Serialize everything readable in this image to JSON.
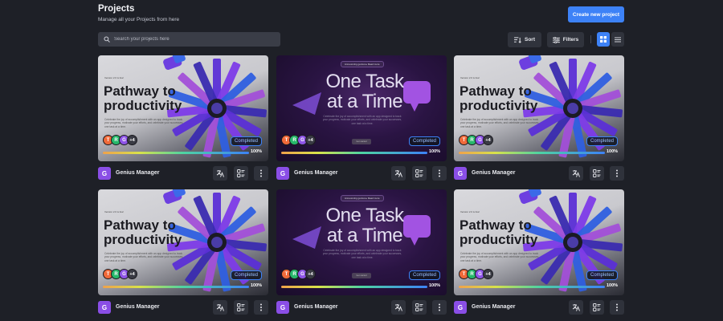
{
  "header": {
    "title": "Projects",
    "subtitle": "Manage all your Projects from here",
    "create_label": "Create new project"
  },
  "search": {
    "placeholder": "Search your projects here"
  },
  "toolbar": {
    "sort_label": "Sort",
    "filters_label": "Filters",
    "active_view": "grid"
  },
  "colors": {
    "accent": "#3d82f7",
    "background": "#1e2027",
    "manager_icon": "#8a4ee6"
  },
  "thumbs": {
    "a": {
      "version": "Version 2.0 is live!",
      "title_line1": "Pathway to",
      "title_line2": "productivity",
      "description": "Celebrate the joy of accomplishment with an app designed to track your progress, motivate your efforts, and celebrate your successes, one task at a time."
    },
    "b": {
      "pill": "Announcing genius ▸ Read more",
      "title_line1": "One Task",
      "title_line2": "at a Time",
      "description": "Celebrate the joy of accomplishment with an app designed to track your progress, motivate your efforts, and celebrate your successes, one task at a time.",
      "button": "Get started"
    }
  },
  "projects": [
    {
      "thumb": "a",
      "avatars": [
        "T",
        "R",
        "G"
      ],
      "more": "+4",
      "status": "Completed",
      "progress": 100,
      "progress_label": "100%",
      "manager_initial": "G",
      "manager": "Genius Manager"
    },
    {
      "thumb": "b",
      "avatars": [
        "T",
        "R",
        "G"
      ],
      "more": "+4",
      "status": "Completed",
      "progress": 100,
      "progress_label": "100%",
      "manager_initial": "G",
      "manager": "Genius Manager"
    },
    {
      "thumb": "a",
      "avatars": [
        "T",
        "R",
        "G"
      ],
      "more": "+4",
      "status": "Completed",
      "progress": 100,
      "progress_label": "100%",
      "manager_initial": "G",
      "manager": "Genius Manager"
    },
    {
      "thumb": "a",
      "avatars": [
        "T",
        "R",
        "G"
      ],
      "more": "+4",
      "status": "Completed",
      "progress": 100,
      "progress_label": "100%",
      "manager_initial": "G",
      "manager": "Genius Manager"
    },
    {
      "thumb": "b",
      "avatars": [
        "T",
        "R",
        "G"
      ],
      "more": "+4",
      "status": "Completed",
      "progress": 100,
      "progress_label": "100%",
      "manager_initial": "G",
      "manager": "Genius Manager"
    },
    {
      "thumb": "a",
      "avatars": [
        "T",
        "R",
        "G"
      ],
      "more": "+4",
      "status": "Completed",
      "progress": 100,
      "progress_label": "100%",
      "manager_initial": "G",
      "manager": "Genius Manager"
    }
  ],
  "card_actions": [
    "translate-icon",
    "tasks-icon",
    "more-vertical-icon"
  ]
}
